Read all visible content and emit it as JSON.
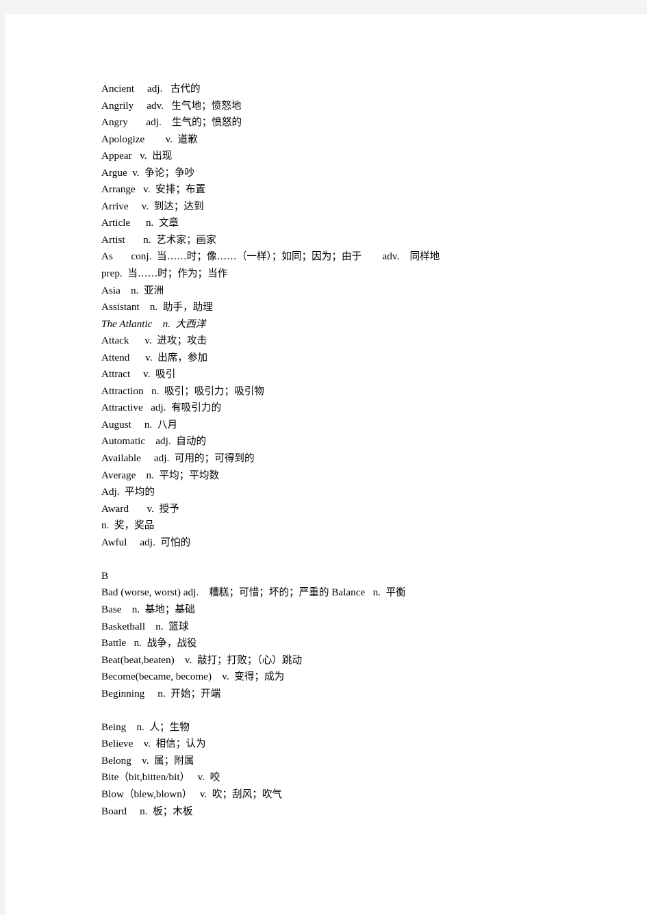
{
  "document": {
    "type": "vocabulary-glossary",
    "page_background": "#ffffff",
    "margin_background": "#f4f4f4",
    "text_color": "#000000",
    "lines": [
      {
        "id": "l1",
        "headword": "Ancient",
        "pos": "adj.",
        "gloss": "古代的",
        "text": "Ancient     adj.   古代的"
      },
      {
        "id": "l2",
        "headword": "Angrily",
        "pos": "adv.",
        "gloss": "生气地；愤怒地",
        "text": "Angrily     adv.   生气地；愤怒地"
      },
      {
        "id": "l3",
        "headword": "Angry",
        "pos": "adj.",
        "gloss": "生气的；愤怒的",
        "text": "Angry       adj.    生气的；愤怒的"
      },
      {
        "id": "l4",
        "headword": "Apologize",
        "pos": "v.",
        "gloss": "道歉",
        "text": "Apologize        v.  道歉"
      },
      {
        "id": "l5",
        "headword": "Appear",
        "pos": "v.",
        "gloss": "出现",
        "text": "Appear   v.  出现"
      },
      {
        "id": "l6",
        "headword": "Argue",
        "pos": "v.",
        "gloss": "争论；争吵",
        "text": "Argue  v.  争论；争吵"
      },
      {
        "id": "l7",
        "headword": "Arrange",
        "pos": "v.",
        "gloss": "安排；布置",
        "text": "Arrange   v.  安排；布置"
      },
      {
        "id": "l8",
        "headword": "Arrive",
        "pos": "v.",
        "gloss": "到达；达到",
        "text": "Arrive     v.  到达；达到"
      },
      {
        "id": "l9",
        "headword": "Article",
        "pos": "n.",
        "gloss": "文章",
        "text": "Article      n.  文章"
      },
      {
        "id": "l10",
        "headword": "Artist",
        "pos": "n.",
        "gloss": "艺术家；画家",
        "text": "Artist       n.  艺术家；画家"
      },
      {
        "id": "l11",
        "headword": "As",
        "pos": "conj.",
        "gloss": "当……时；像……（一样）；如同；因为；由于        adv.    同样地",
        "text": "As       conj.  当……时；像……（一样）；如同；因为；由于        adv.    同样地"
      },
      {
        "id": "l12",
        "headword": "",
        "pos": "prep.",
        "gloss": "当……时；作为；当作",
        "text": "prep.  当……时；作为；当作"
      },
      {
        "id": "l13",
        "headword": "Asia",
        "pos": "n.",
        "gloss": "亚洲",
        "text": "Asia    n.  亚洲"
      },
      {
        "id": "l14",
        "headword": "Assistant",
        "pos": "n.",
        "gloss": "助手，助理",
        "text": "Assistant    n.  助手，助理"
      },
      {
        "id": "l15",
        "headword": "The Atlantic",
        "pos": "n.",
        "gloss": "大西洋",
        "text": "The Atlantic    n.  大西洋",
        "italic_headword": true
      },
      {
        "id": "l16",
        "headword": "Attack",
        "pos": "v.",
        "gloss": "进攻；攻击",
        "text": "Attack      v.  进攻；攻击"
      },
      {
        "id": "l17",
        "headword": "Attend",
        "pos": "v.",
        "gloss": "出席，参加",
        "text": "Attend      v.  出席，参加"
      },
      {
        "id": "l18",
        "headword": "Attract",
        "pos": "v.",
        "gloss": "吸引",
        "text": "Attract     v.  吸引"
      },
      {
        "id": "l19",
        "headword": "Attraction",
        "pos": "n.",
        "gloss": "吸引；吸引力；吸引物",
        "text": "Attraction   n.  吸引；吸引力；吸引物"
      },
      {
        "id": "l20",
        "headword": "Attractive",
        "pos": "adj.",
        "gloss": "有吸引力的",
        "text": "Attractive   adj.  有吸引力的"
      },
      {
        "id": "l21",
        "headword": "August",
        "pos": "n.",
        "gloss": "八月",
        "text": "August     n.  八月"
      },
      {
        "id": "l22",
        "headword": "Automatic",
        "pos": "adj.",
        "gloss": "自动的",
        "text": "Automatic    adj.  自动的"
      },
      {
        "id": "l23",
        "headword": "Available",
        "pos": "adj.",
        "gloss": "可用的；可得到的",
        "text": "Available     adj.  可用的；可得到的"
      },
      {
        "id": "l24",
        "headword": "Average",
        "pos": "n.",
        "gloss": "平均；平均数",
        "text": "Average    n.  平均；平均数"
      },
      {
        "id": "l25",
        "headword": "",
        "pos": "Adj.",
        "gloss": "平均的",
        "text": "Adj.  平均的"
      },
      {
        "id": "l26",
        "headword": "Award",
        "pos": "v.",
        "gloss": "授予",
        "text": "Award       v.  授予"
      },
      {
        "id": "l27",
        "headword": "",
        "pos": "n.",
        "gloss": "奖，奖品",
        "text": "n.  奖，奖品"
      },
      {
        "id": "l28",
        "headword": "Awful",
        "pos": "adj.",
        "gloss": "可怕的",
        "text": "Awful     adj.  可怕的"
      },
      {
        "id": "l29",
        "headword": "",
        "pos": "",
        "gloss": "",
        "text": "",
        "blank": true
      },
      {
        "id": "l30",
        "headword": "B",
        "pos": "",
        "gloss": "",
        "text": "B",
        "section": true
      },
      {
        "id": "l31",
        "headword": "Bad (worse, worst)",
        "pos": "adj.",
        "gloss": "糟糕；可惜；坏的；严重的 Balance   n.  平衡",
        "text": "Bad (worse, worst) adj.    糟糕；可惜；坏的；严重的 Balance   n.  平衡"
      },
      {
        "id": "l32",
        "headword": "Base",
        "pos": "n.",
        "gloss": "基地；基础",
        "text": "Base    n.  基地；基础"
      },
      {
        "id": "l33",
        "headword": "Basketball",
        "pos": "n.",
        "gloss": "篮球",
        "text": "Basketball    n.  篮球"
      },
      {
        "id": "l34",
        "headword": "Battle",
        "pos": "n.",
        "gloss": "战争，战役",
        "text": "Battle   n.  战争，战役"
      },
      {
        "id": "l35",
        "headword": "Beat(beat,beaten)",
        "pos": "v.",
        "gloss": "敲打；打败；（心）跳动",
        "text": "Beat(beat,beaten)    v.  敲打；打败；（心）跳动"
      },
      {
        "id": "l36",
        "headword": "Become(became, become)",
        "pos": "v.",
        "gloss": "变得；成为",
        "text": "Become(became, become)    v.  变得；成为"
      },
      {
        "id": "l37",
        "headword": "Beginning",
        "pos": "n.",
        "gloss": "开始；开端",
        "text": "Beginning     n.  开始；开端"
      },
      {
        "id": "l38",
        "headword": "",
        "pos": "",
        "gloss": "",
        "text": "",
        "blank": true
      },
      {
        "id": "l39",
        "headword": "Being",
        "pos": "n.",
        "gloss": "人；生物",
        "text": "Being    n.  人；生物"
      },
      {
        "id": "l40",
        "headword": "Believe",
        "pos": "v.",
        "gloss": "相信；认为",
        "text": "Believe    v.  相信；认为"
      },
      {
        "id": "l41",
        "headword": "Belong",
        "pos": "v.",
        "gloss": "属；附属",
        "text": "Belong    v.  属；附属"
      },
      {
        "id": "l42",
        "headword": "Bite（bit,bitten/bit）",
        "pos": "v.",
        "gloss": "咬",
        "text": "Bite（bit,bitten/bit）   v.  咬"
      },
      {
        "id": "l43",
        "headword": "Blow（blew,blown）",
        "pos": "v.",
        "gloss": "吹；刮风；吹气",
        "text": "Blow（blew,blown）   v.  吹；刮风；吹气"
      },
      {
        "id": "l44",
        "headword": "Board",
        "pos": "n.",
        "gloss": "板；木板",
        "text": "Board     n.  板；木板"
      }
    ]
  }
}
